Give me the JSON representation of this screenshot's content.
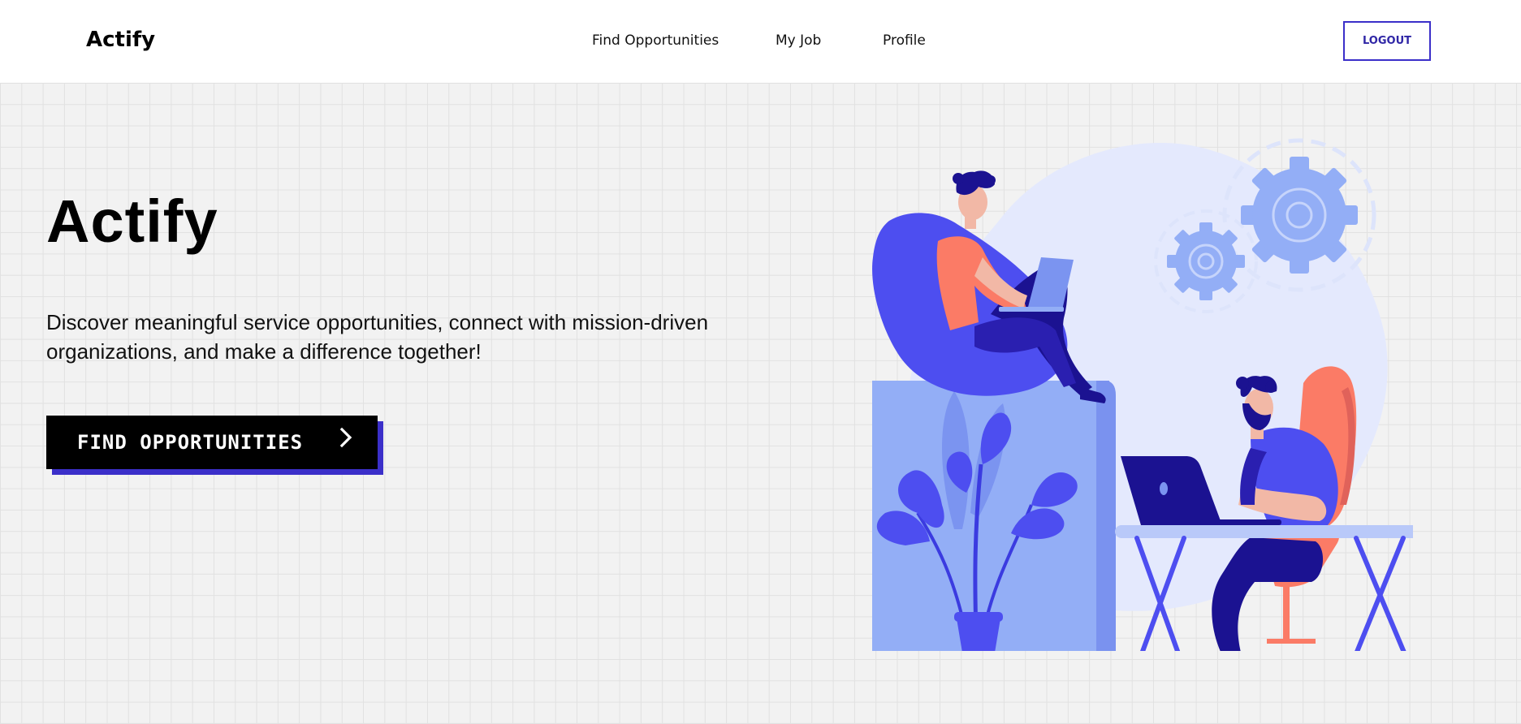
{
  "header": {
    "brand": "Actify",
    "nav": [
      {
        "label": "Find Opportunities"
      },
      {
        "label": "My Job"
      },
      {
        "label": "Profile"
      }
    ],
    "logout_label": "LOGOUT"
  },
  "hero": {
    "title": "Actify",
    "description": "Discover meaningful service opportunities, connect with mission-driven organizations, and make a difference together!",
    "cta_label": "FIND OPPORTUNITIES",
    "illustration": "remote-work-illustration"
  },
  "colors": {
    "accent": "#3b2fc9",
    "illustration_blue": "#4d4ef0",
    "illustration_light_blue": "#93aef6",
    "illustration_coral": "#fb7b66",
    "background": "#f2f2f2"
  },
  "icons": {
    "cta": "chevron-right-icon"
  }
}
